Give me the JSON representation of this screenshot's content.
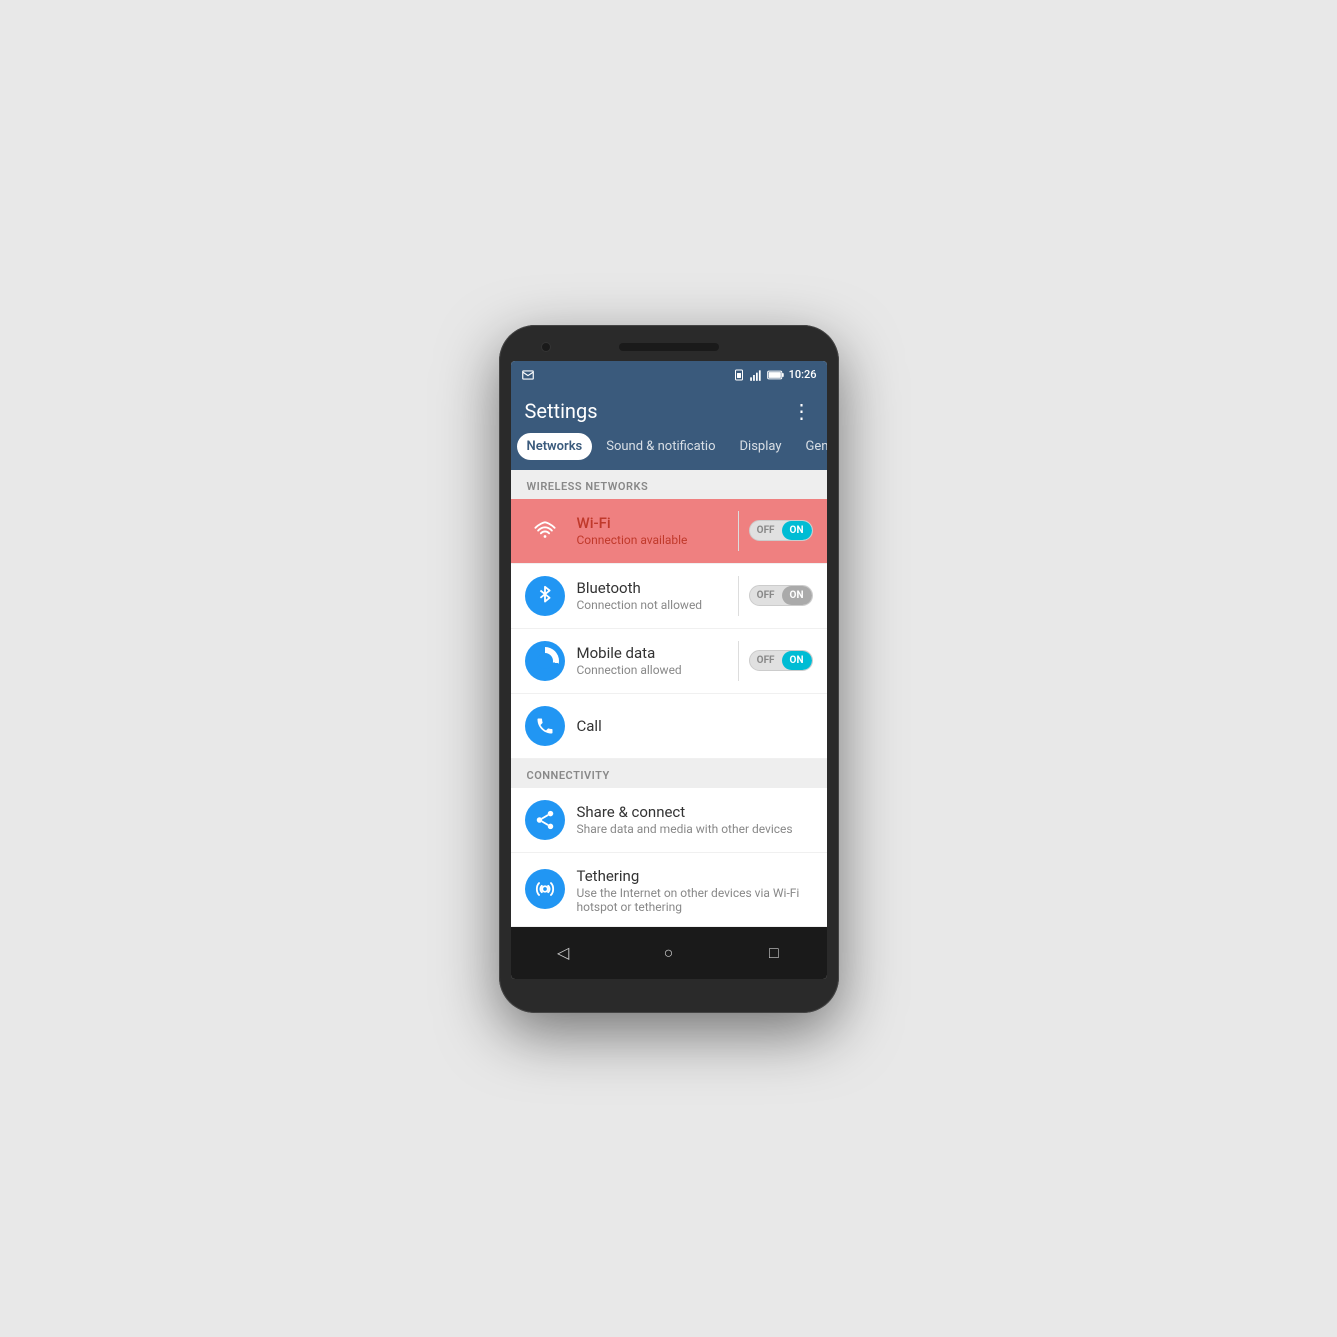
{
  "phone": {
    "status_bar": {
      "time": "10:26",
      "signal_icon": "signal-icon",
      "battery_icon": "battery-icon",
      "notification_icon": "notification-icon"
    },
    "app_bar": {
      "title": "Settings",
      "more_label": "⋮"
    },
    "tabs": [
      {
        "label": "Networks",
        "active": true
      },
      {
        "label": "Sound & notificatio",
        "active": false
      },
      {
        "label": "Display",
        "active": false
      },
      {
        "label": "General",
        "active": false
      }
    ],
    "sections": [
      {
        "header": "WIRELESS NETWORKS",
        "items": [
          {
            "id": "wifi",
            "title": "Wi-Fi",
            "subtitle": "Connection available",
            "highlighted": true,
            "has_toggle": true,
            "toggle_state": "on"
          },
          {
            "id": "bluetooth",
            "title": "Bluetooth",
            "subtitle": "Connection not allowed",
            "highlighted": false,
            "has_toggle": true,
            "toggle_state": "off"
          },
          {
            "id": "mobile-data",
            "title": "Mobile data",
            "subtitle": "Connection allowed",
            "highlighted": false,
            "has_toggle": true,
            "toggle_state": "on"
          },
          {
            "id": "call",
            "title": "Call",
            "subtitle": "",
            "highlighted": false,
            "has_toggle": false
          }
        ]
      },
      {
        "header": "CONNECTIVITY",
        "items": [
          {
            "id": "share-connect",
            "title": "Share & connect",
            "subtitle": "Share data and media with other devices",
            "highlighted": false,
            "has_toggle": false
          },
          {
            "id": "tethering",
            "title": "Tethering",
            "subtitle": "Use the Internet on other devices via Wi-Fi hotspot or tethering",
            "highlighted": false,
            "has_toggle": false
          }
        ]
      }
    ],
    "nav": {
      "back": "◁",
      "home": "○",
      "recent": "□"
    },
    "toggles": {
      "off_label": "OFF",
      "on_label": "ON"
    }
  }
}
